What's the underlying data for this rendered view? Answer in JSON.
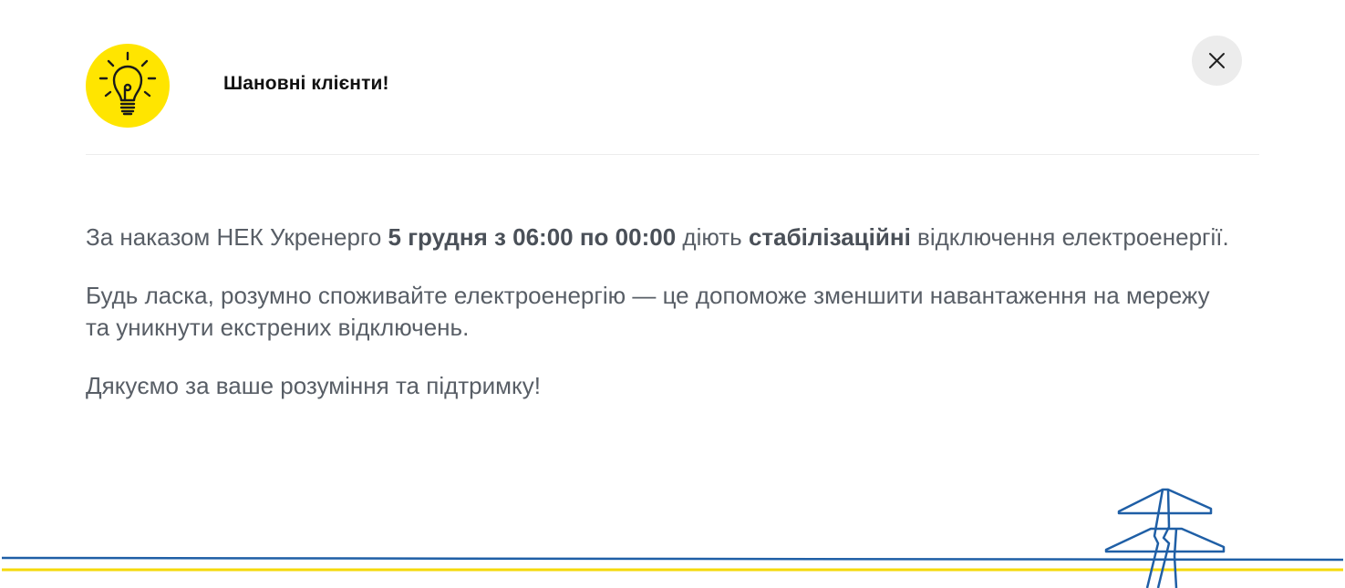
{
  "dialog": {
    "title": "Шановні клієнти!",
    "close_label": "Закрити"
  },
  "icons": {
    "header": "lightbulb-icon",
    "close": "close-icon",
    "footer": "power-pylon-icon"
  },
  "message": {
    "p1_part1": "За наказом НЕК Укренерго ",
    "p1_bold1": "5 грудня з 06:00 по 00:00",
    "p1_part2": " діють ",
    "p1_bold2": "стабілізаційні",
    "p1_part3": " відключення електроенергії.",
    "p2": "Будь ласка, розумно споживайте електроенергію — це допоможе зменшити навантаження на мережу та уникнути екстрених відключень.",
    "p3": "Дякуємо за ваше розуміння та підтримку!"
  },
  "colors": {
    "bulb_bg": "#FFE500",
    "blue_line": "#1F5FA6",
    "yellow_line": "#F5D90A",
    "text": "#585E66",
    "close_bg": "#ECECEC"
  }
}
